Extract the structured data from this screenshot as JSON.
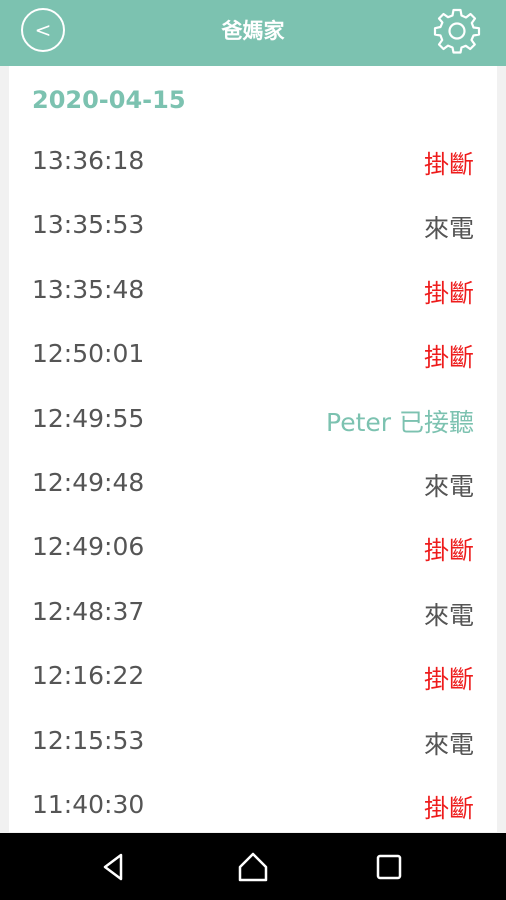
{
  "header": {
    "title": "爸媽家",
    "back_icon": "chevron-left-icon",
    "settings_icon": "gear-icon"
  },
  "log": {
    "date": "2020-04-15",
    "entries": [
      {
        "time": "13:36:18",
        "status": "掛斷",
        "kind": "hangup"
      },
      {
        "time": "13:35:53",
        "status": "來電",
        "kind": "incoming"
      },
      {
        "time": "13:35:48",
        "status": "掛斷",
        "kind": "hangup"
      },
      {
        "time": "12:50:01",
        "status": "掛斷",
        "kind": "hangup"
      },
      {
        "time": "12:49:55",
        "status": "Peter 已接聽",
        "kind": "answered"
      },
      {
        "time": "12:49:48",
        "status": "來電",
        "kind": "incoming"
      },
      {
        "time": "12:49:06",
        "status": "掛斷",
        "kind": "hangup"
      },
      {
        "time": "12:48:37",
        "status": "來電",
        "kind": "incoming"
      },
      {
        "time": "12:16:22",
        "status": "掛斷",
        "kind": "hangup"
      },
      {
        "time": "12:15:53",
        "status": "來電",
        "kind": "incoming"
      },
      {
        "time": "11:40:30",
        "status": "掛斷",
        "kind": "hangup"
      }
    ]
  },
  "colors": {
    "accent": "#7cc2b0",
    "hangup": "#ee1c1c",
    "text": "#555555"
  },
  "navbar": {
    "icons": [
      "back-triangle-icon",
      "home-icon",
      "recents-square-icon"
    ]
  }
}
